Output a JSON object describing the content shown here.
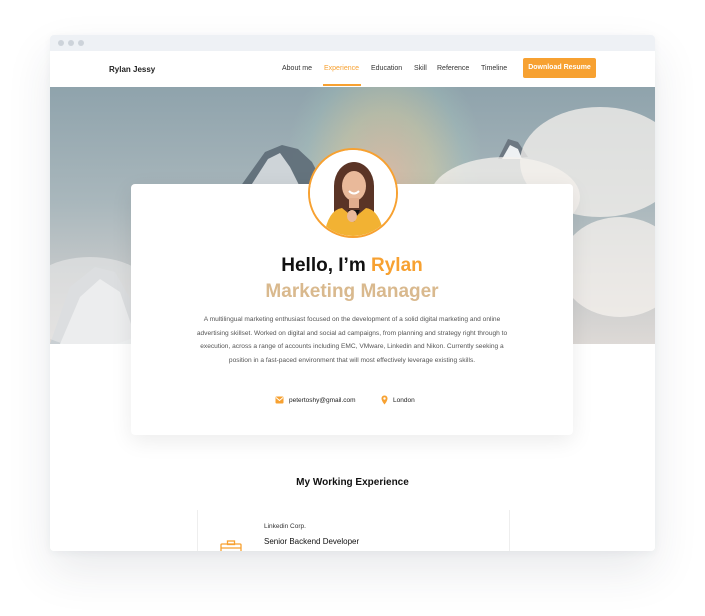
{
  "nav": {
    "brand": "Rylan Jessy",
    "links": [
      "About me",
      "Experience",
      "Education",
      "Skill",
      "Reference",
      "Timeline"
    ],
    "active_link": "Experience",
    "cta": "Download Resume"
  },
  "profile": {
    "greeting": "Hello, I’m ",
    "name": "Rylan",
    "title": "Marketing Manager",
    "description": "A multilingual marketing enthusiast focused on the development of a solid digital marketing and online advertising skillset. Worked on digital and social ad campaigns, from planning and strategy right through to execution, across a range of accounts including EMC, VMware, Linkedin and Nikon. Currently seeking a position in a fast-paced environment that will most effectively leverage existing skills.",
    "email": "petertoshy@gmail.com",
    "location": "London"
  },
  "experience": {
    "heading": "My Working Experience",
    "items": [
      {
        "company": "Linkedin Corp.",
        "role": "Senior Backend Developer"
      }
    ]
  },
  "icons": {
    "email": "mail-icon",
    "location": "map-pin-icon",
    "experience": "briefcase-icon"
  },
  "colors": {
    "accent": "#f7a131",
    "title_tan": "#d9b98e",
    "text": "#111111"
  }
}
